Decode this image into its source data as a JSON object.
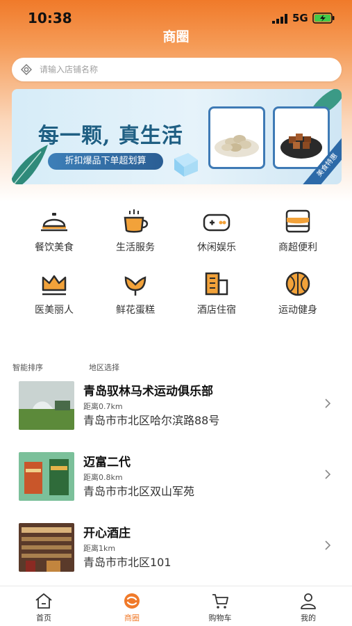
{
  "status_bar": {
    "time": "10:38",
    "network": "5G"
  },
  "header": {
    "title": "商圈"
  },
  "search": {
    "placeholder": "请输入店铺名称"
  },
  "banner": {
    "headline": "每一颗, 真生活",
    "button_label": "折扣爆品下单超划算",
    "tag": "美食特惠"
  },
  "categories": [
    {
      "label": "餐饮美食",
      "icon": "food-cloche-icon"
    },
    {
      "label": "生活服务",
      "icon": "cup-icon"
    },
    {
      "label": "休闲娱乐",
      "icon": "gamepad-icon"
    },
    {
      "label": "商超便利",
      "icon": "store-icon"
    },
    {
      "label": "医美丽人",
      "icon": "crown-icon"
    },
    {
      "label": "鲜花蛋糕",
      "icon": "flower-icon"
    },
    {
      "label": "酒店住宿",
      "icon": "hotel-icon"
    },
    {
      "label": "运动健身",
      "icon": "basketball-icon"
    }
  ],
  "filters": {
    "sort_label": "智能排序",
    "region_label": "地区选择"
  },
  "stores": [
    {
      "name": "青岛驭林马术运动俱乐部",
      "distance": "距离0.7km",
      "address": "青岛市市北区哈尔滨路88号"
    },
    {
      "name": "迈富二代",
      "distance": "距离0.8km",
      "address": "青岛市市北区双山军苑"
    },
    {
      "name": "开心酒庄",
      "distance": "距离1km",
      "address": "青岛市市北区101"
    }
  ],
  "bottom_nav": {
    "items": [
      {
        "label": "首页",
        "icon": "home-icon"
      },
      {
        "label": "商圈",
        "icon": "shop-circle-icon",
        "active": true
      },
      {
        "label": "购物车",
        "icon": "cart-icon"
      },
      {
        "label": "我的",
        "icon": "user-icon"
      }
    ]
  },
  "colors": {
    "accent": "#f07a2a",
    "icon_dark": "#2b2b2b",
    "icon_orange": "#f2a23a"
  }
}
